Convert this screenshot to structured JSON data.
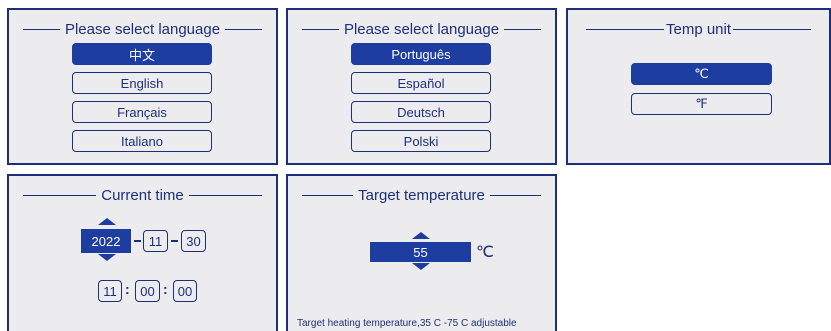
{
  "language_panel_1": {
    "title": "Please select language",
    "options": [
      {
        "label": "中文",
        "selected": true
      },
      {
        "label": "English",
        "selected": false
      },
      {
        "label": "Français",
        "selected": false
      },
      {
        "label": "Italiano",
        "selected": false
      }
    ]
  },
  "language_panel_2": {
    "title": "Please select language",
    "options": [
      {
        "label": "Português",
        "selected": true
      },
      {
        "label": "Español",
        "selected": false
      },
      {
        "label": "Deutsch",
        "selected": false
      },
      {
        "label": "Polski",
        "selected": false
      }
    ]
  },
  "temp_unit_panel": {
    "title": "Temp unit",
    "options": [
      {
        "label": "℃",
        "selected": true
      },
      {
        "label": "℉",
        "selected": false
      }
    ]
  },
  "time_panel": {
    "title": "Current time",
    "year": "2022",
    "month": "11",
    "day": "30",
    "hour": "11",
    "minute": "00",
    "second": "00"
  },
  "target_temp_panel": {
    "title": "Target temperature",
    "value": "55",
    "unit": "℃",
    "note": "Target heating temperature,35 C -75 C adjustable"
  },
  "colors": {
    "accent": "#1e3da0",
    "border": "#1e2f7a",
    "panel_bg": "#ececee"
  }
}
